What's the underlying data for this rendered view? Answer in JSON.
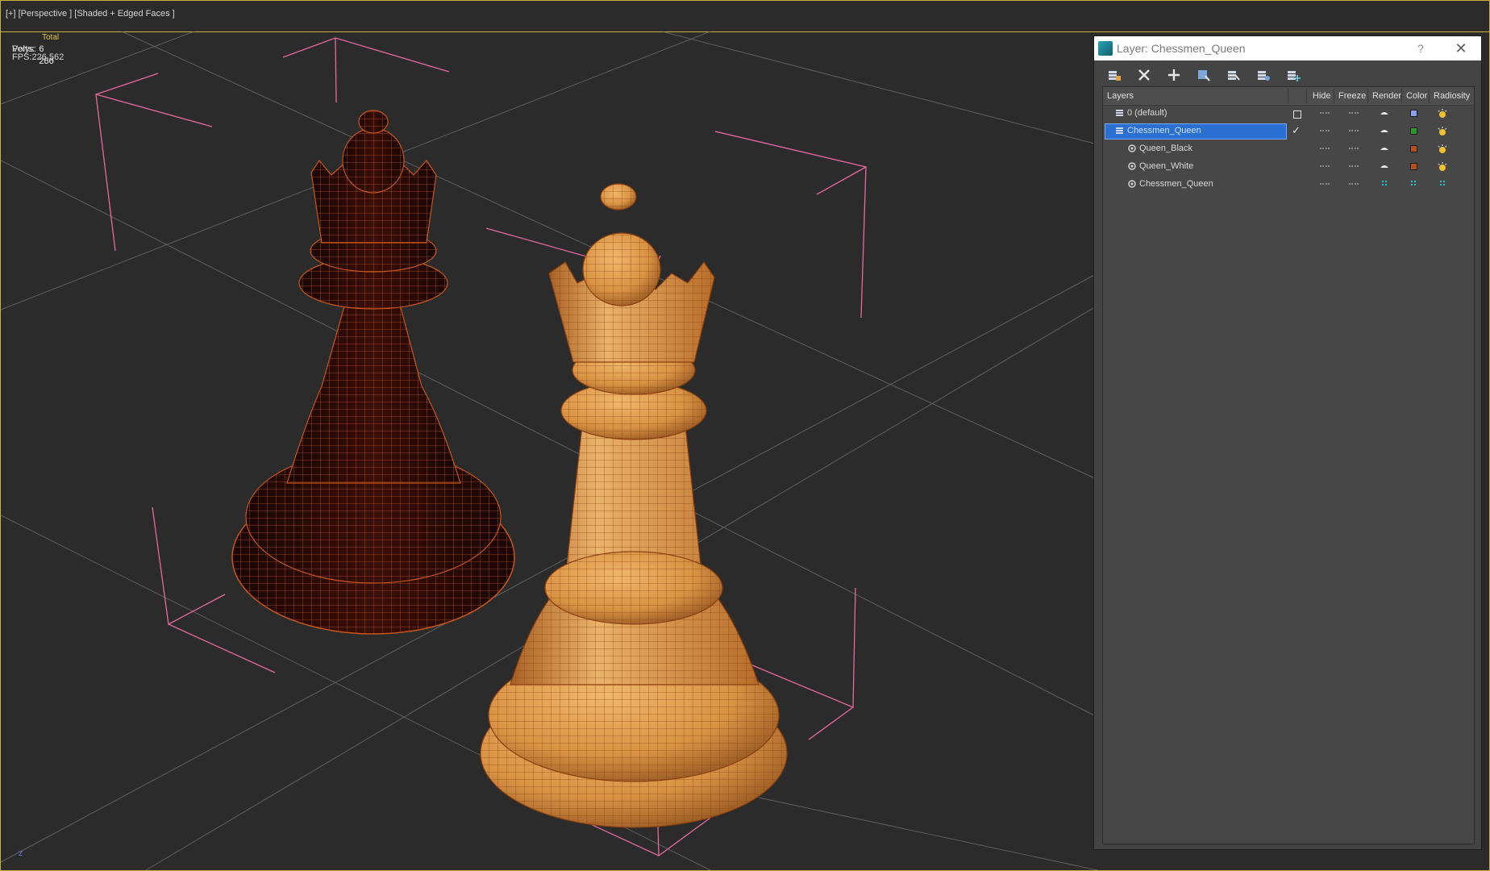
{
  "viewport": {
    "label": "[+] [Perspective ] [Shaded + Edged Faces ]",
    "stats": {
      "header": "Total",
      "polys_label": "Polys:",
      "polys_value": "6 256",
      "verts_label": "Verts:",
      "verts_value": "6 260",
      "fps_label": "FPS:",
      "fps_value": "226,562"
    },
    "axis_label": "z"
  },
  "dialog": {
    "title": "Layer: Chessmen_Queen",
    "help": "?",
    "close": "✕",
    "toolbar": [
      "create-layer-icon",
      "delete-layer-icon",
      "add-to-layer-icon",
      "select-objects-icon",
      "select-layer-icon",
      "hide-all-icon",
      "freeze-all-icon"
    ],
    "columns": {
      "layers": "Layers",
      "hide": "Hide",
      "freeze": "Freeze",
      "render": "Render",
      "color": "Color",
      "radiosity": "Radiosity"
    },
    "rows": [
      {
        "name": "0 (default)",
        "type": "layer",
        "current": false,
        "color": "#8aa0f0"
      },
      {
        "name": "Chessmen_Queen",
        "type": "layer",
        "current": true,
        "selected": true,
        "color": "#2c9a2c"
      },
      {
        "name": "Queen_Black",
        "type": "object",
        "color": "#b5501a"
      },
      {
        "name": "Queen_White",
        "type": "object",
        "color": "#b5501a"
      },
      {
        "name": "Chessmen_Queen",
        "type": "object",
        "color": null
      }
    ]
  }
}
